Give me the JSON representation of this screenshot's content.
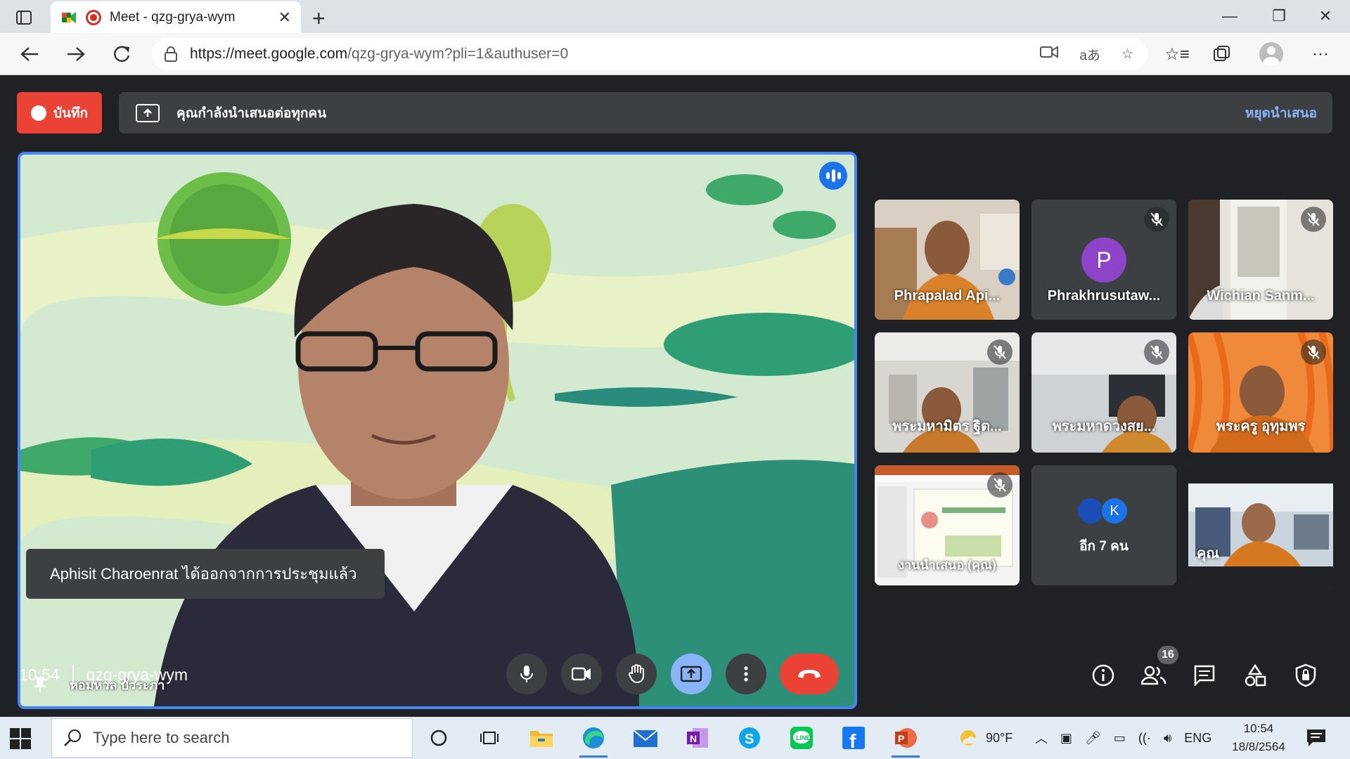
{
  "browser": {
    "tab_title": "Meet - qzg-grya-wym",
    "url_host": "https://meet.google.com",
    "url_path": "/qzg-grya-wym?pli=1&authuser=0"
  },
  "meet": {
    "record_label": "บันทึก",
    "presenting_text": "คุณกำลังนำเสนอต่อทุกคน",
    "stop_presenting": "หยุดนำเสนอ",
    "main_participant": "หอมหวล บัวระภา",
    "toast": "Aphisit Charoenrat ได้ออกจากการประชุมแล้ว",
    "time": "10:54",
    "meeting_code": "qzg-grya-wym",
    "participant_count": "16",
    "tiles": [
      {
        "name": "Phrapalad Api...",
        "muted": false
      },
      {
        "name": "Phrakhrusutaw...",
        "muted": true,
        "avatar_letter": "P"
      },
      {
        "name": "Wichian Sanm...",
        "muted": true
      },
      {
        "name": "พระมหามิตร ฐิต...",
        "muted": true
      },
      {
        "name": "พระมหาดวงสย...",
        "muted": true
      },
      {
        "name": "พระครู อุทุมพร",
        "muted": true
      },
      {
        "name": "งานนำเสนอ (คุณ)",
        "muted": true
      },
      {
        "name": "อีก 7 คน",
        "avatar_letter": "K"
      },
      {
        "name": "คุณ",
        "muted": false
      }
    ]
  },
  "taskbar": {
    "search_placeholder": "Type here to search",
    "weather": "90°F",
    "lang": "ENG",
    "time": "10:54",
    "date": "18/8/2564"
  },
  "colors": {
    "accent": "#1a73e8",
    "end_call": "#ea4335",
    "meet_bg": "#202124"
  }
}
